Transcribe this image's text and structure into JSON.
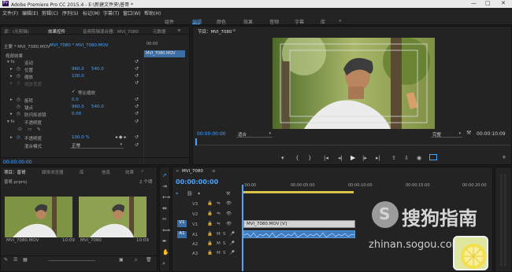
{
  "app": {
    "logo": "Pr",
    "title": "Adobe Premiere Pro CC 2015.4 - E:\\新建文件夹\\普哥 *",
    "window_controls": [
      "—",
      "□",
      "✕"
    ]
  },
  "menu": [
    "文件(F)",
    "编辑(E)",
    "剪辑(C)",
    "序列(S)",
    "标记(M)",
    "字幕(T)",
    "窗口(W)",
    "帮助(H)"
  ],
  "workspaces": {
    "items": [
      "组件",
      "编辑",
      "颜色",
      "效果",
      "音频",
      "字幕",
      "库"
    ],
    "active": "编辑",
    "more": "»"
  },
  "effect_controls": {
    "tabs": [
      "源：(无剪辑)",
      "效果控件",
      "音频剪辑混合器：MVI_7080",
      "元数据"
    ],
    "menu_icon": "≡",
    "master": "主要 * MVI_7080.MOV",
    "clip": "MVI_7080 * MVI_7080.MOV",
    "ruler_time": "00:00",
    "clip_bar": "MVI_7080.MOV",
    "section_video": "视频效果",
    "motion": "运动",
    "position_label": "位置",
    "position_x": "960.0",
    "position_y": "540.0",
    "scale_label": "缩放",
    "scale_value": "100.0",
    "scale_width_label": "缩放宽度",
    "uniform_scale": "等比缩放",
    "rotation_label": "旋转",
    "rotation_value": "0.0",
    "anchor_label": "锚点",
    "anchor_x": "960.0",
    "anchor_y": "540.0",
    "flicker_label": "防闪烁滤镜",
    "flicker_value": "0.00",
    "opacity": "不透明度",
    "opacity_label": "不透明度",
    "opacity_value": "100.0 %",
    "blend_label": "混合模式",
    "blend_value": "正常",
    "timecode": "00:00:00:00"
  },
  "program": {
    "title": "节目：MVI_7080",
    "menu_icon": "≡",
    "timecode": "00:00:00:00",
    "fit": "适合",
    "quality": "完整",
    "duration": "00:00:10:09",
    "wrench_icon": "🔧"
  },
  "project": {
    "tabs": [
      "项目：普哥",
      "媒体浏览器",
      "库",
      "信息",
      "效果",
      "标记",
      "历史记录"
    ],
    "menu_icon": "≡",
    "file": "普哥.prproj",
    "count": "2 个项",
    "items": [
      {
        "name": "MVI_7080.MOV",
        "duration": "10:09"
      },
      {
        "name": "MVI_7080",
        "duration": "10:09"
      }
    ]
  },
  "timeline": {
    "close_icon": "×",
    "sequence": "MVI_7080",
    "menu_icon": "≡",
    "timecode": "00:00:00:00",
    "ruler": [
      ":00:00",
      "00:00:05:00",
      "00:00:10:00",
      "00:00:15:00",
      "00:00:20:00"
    ],
    "tracks": [
      {
        "name": "V3",
        "target": "",
        "clip": ""
      },
      {
        "name": "V2",
        "target": "",
        "clip": ""
      },
      {
        "name": "V1",
        "target": "V1",
        "clip": "MVI_7080.MOV [V]"
      },
      {
        "name": "A1",
        "target": "A1",
        "clip": ""
      },
      {
        "name": "A2",
        "target": "",
        "clip": ""
      },
      {
        "name": "A3",
        "target": "",
        "clip": ""
      }
    ],
    "track_letters": [
      "M",
      "S"
    ]
  },
  "watermark": {
    "brand": "搜狗指南",
    "url": "zhinan.sogou.com"
  }
}
